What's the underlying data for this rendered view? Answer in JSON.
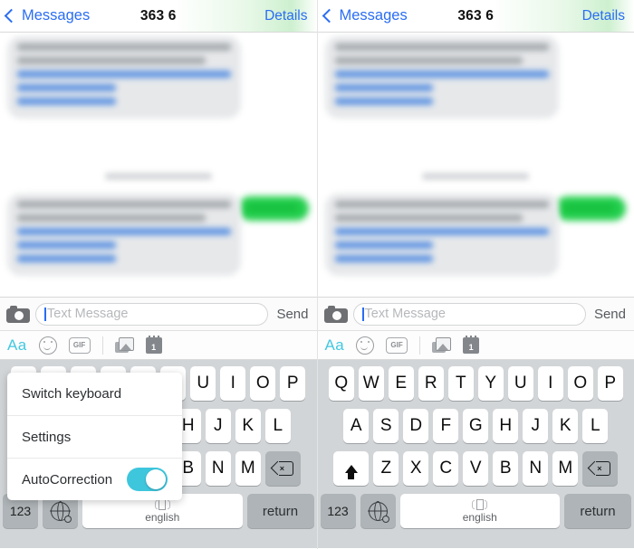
{
  "navbar": {
    "back_label": "Messages",
    "title": "363 6",
    "details_label": "Details",
    "back_icon": "chevron-left-icon"
  },
  "conversation": {
    "incoming_bubble_color": "#e6e8ea",
    "outgoing_bubble_color": "#23cf4d",
    "link_color": "#3f7fe0",
    "timestamp_blurred": true,
    "messages": [
      {
        "type": "incoming",
        "blurred": true,
        "lines": 5
      },
      {
        "type": "timestamp",
        "blurred": true
      },
      {
        "type": "outgoing",
        "blurred": true,
        "lines": 1
      },
      {
        "type": "incoming",
        "blurred": true,
        "lines": 5
      }
    ]
  },
  "input_bar": {
    "camera_icon": "camera-icon",
    "placeholder": "Text Message",
    "value": "",
    "send_label": "Send"
  },
  "app_toolbar": {
    "items": [
      {
        "name": "text-format-icon",
        "label": "Aa"
      },
      {
        "name": "smiley-icon",
        "label": ""
      },
      {
        "name": "gif-icon",
        "label": "GIF"
      },
      {
        "name": "photos-icon",
        "label": ""
      },
      {
        "name": "calendar-icon",
        "label": "1"
      }
    ],
    "aa_color": "#43c8e0"
  },
  "keyboard": {
    "background": "#d2d5d7",
    "row1": [
      "Q",
      "W",
      "E",
      "R",
      "T",
      "Y",
      "U",
      "I",
      "O",
      "P"
    ],
    "row2": [
      "A",
      "S",
      "D",
      "F",
      "G",
      "H",
      "J",
      "K",
      "L"
    ],
    "row3": [
      "Z",
      "X",
      "C",
      "V",
      "B",
      "N",
      "M"
    ],
    "shift_icon": "shift-icon",
    "backspace_icon": "backspace-icon",
    "numeric_label": "123",
    "globe_icon": "globe-icon",
    "space_label": "english",
    "space_icon": "space-swipe-icon",
    "return_label": "return"
  },
  "popup_menu": {
    "items": [
      {
        "label": "Switch keyboard",
        "type": "action"
      },
      {
        "label": "Settings",
        "type": "action"
      },
      {
        "label": "AutoCorrection",
        "type": "toggle",
        "enabled": true
      }
    ],
    "toggle_on_color": "#3ec6dd"
  }
}
